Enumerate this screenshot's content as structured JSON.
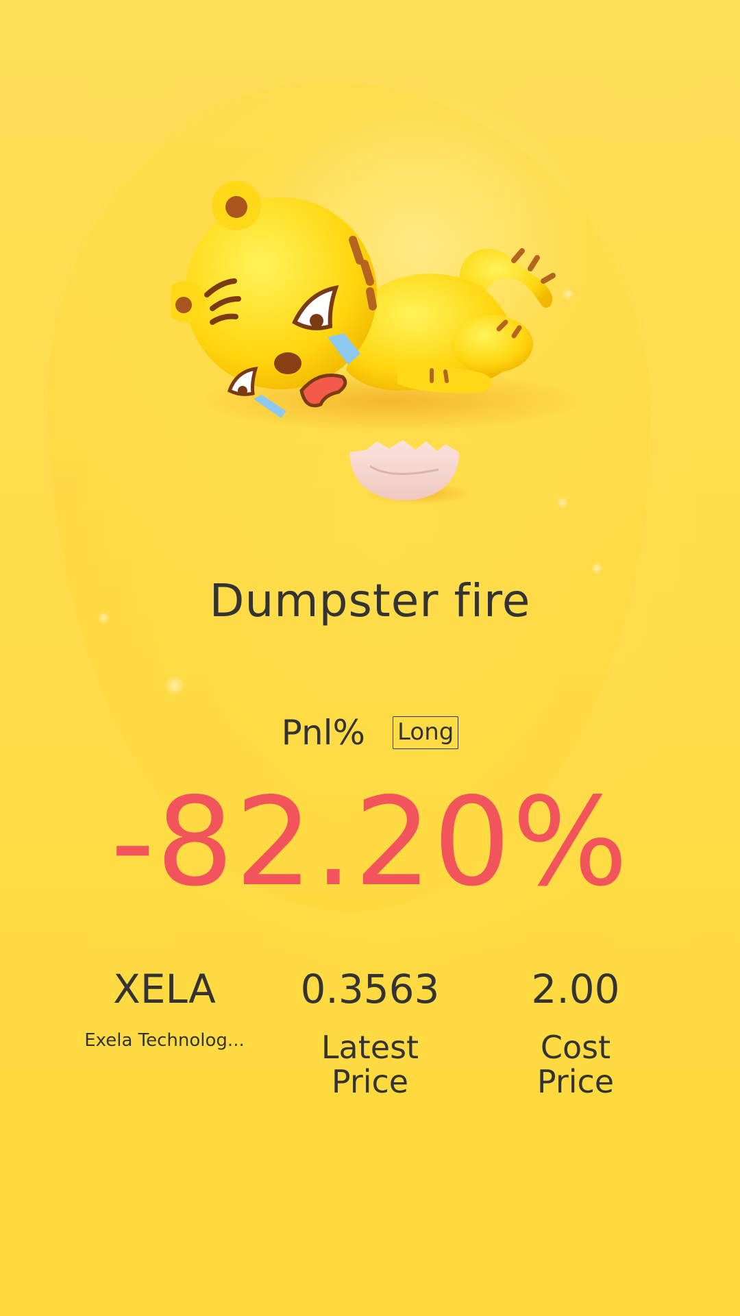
{
  "mood": {
    "title": "Dumpster fire",
    "illustration": "crying-tiger-mascot-with-broken-eggshell"
  },
  "pnl": {
    "label": "Pnl%",
    "side_badge": "Long",
    "value": "-82.20%",
    "value_color": "#f2545b"
  },
  "stats": {
    "symbol": {
      "ticker": "XELA",
      "name": "Exela Technolog..."
    },
    "latest_price": {
      "value": "0.3563",
      "label": "Latest Price"
    },
    "cost_price": {
      "value": "2.00",
      "label": "Cost Price"
    }
  },
  "colors": {
    "background": "#ffdc4a",
    "text": "#333333",
    "loss": "#f2545b"
  }
}
